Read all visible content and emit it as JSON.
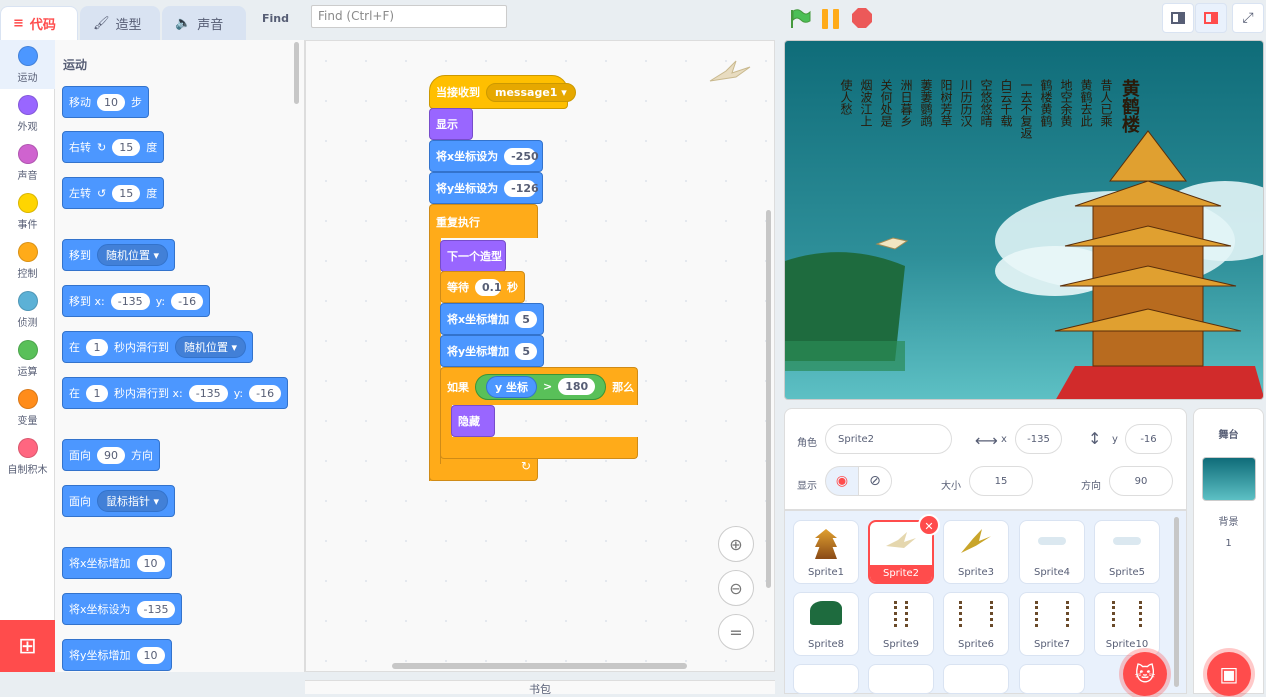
{
  "tabs": [
    {
      "label": "代码",
      "icon": "code-icon"
    },
    {
      "label": "造型",
      "icon": "brush-icon"
    },
    {
      "label": "声音",
      "icon": "speaker-icon"
    }
  ],
  "find": {
    "label": "Find",
    "placeholder": "Find (Ctrl+F)"
  },
  "categories": [
    {
      "label": "运动",
      "color": "#4c97ff"
    },
    {
      "label": "外观",
      "color": "#9966ff"
    },
    {
      "label": "声音",
      "color": "#cf63cf"
    },
    {
      "label": "事件",
      "color": "#ffd500"
    },
    {
      "label": "控制",
      "color": "#ffab19"
    },
    {
      "label": "侦测",
      "color": "#5cb1d6"
    },
    {
      "label": "运算",
      "color": "#59c059"
    },
    {
      "label": "变量",
      "color": "#ff8c1a"
    },
    {
      "label": "自制积木",
      "color": "#ff6680"
    }
  ],
  "palette": {
    "title": "运动",
    "move": {
      "a": "移动",
      "v": "10",
      "b": "步"
    },
    "turn_right": {
      "a": "右转",
      "v": "15",
      "b": "度"
    },
    "turn_left": {
      "a": "左转",
      "v": "15",
      "b": "度"
    },
    "goto": {
      "a": "移到",
      "v": "随机位置"
    },
    "goto_xy": {
      "a": "移到 x:",
      "x": "-135",
      "b": "y:",
      "y": "-16"
    },
    "glide": {
      "a": "在",
      "v": "1",
      "b": "秒内滑行到",
      "d": "随机位置"
    },
    "glide_xy": {
      "a": "在",
      "v": "1",
      "b": "秒内滑行到 x:",
      "x": "-135",
      "c": "y:",
      "y": "-16"
    },
    "point": {
      "a": "面向",
      "v": "90",
      "b": "方向"
    },
    "point_to": {
      "a": "面向",
      "v": "鼠标指针"
    },
    "change_x": {
      "a": "将x坐标增加",
      "v": "10"
    },
    "set_x": {
      "a": "将x坐标设为",
      "v": "-135"
    },
    "change_y": {
      "a": "将y坐标增加",
      "v": "10"
    }
  },
  "script": {
    "hat": {
      "a": "当接收到",
      "v": "message1"
    },
    "show": "显示",
    "setx": {
      "a": "将x坐标设为",
      "v": "-250"
    },
    "sety": {
      "a": "将y坐标设为",
      "v": "-126"
    },
    "forever": "重复执行",
    "nextcostume": "下一个造型",
    "wait": {
      "a": "等待",
      "v": "0.1",
      "b": "秒"
    },
    "changex": {
      "a": "将x坐标增加",
      "v": "5"
    },
    "changey": {
      "a": "将y坐标增加",
      "v": "5"
    },
    "if": {
      "a": "如果",
      "sensor": "y 坐标",
      "op": ">",
      "v": "180",
      "b": "那么"
    },
    "hide": "隐藏"
  },
  "backpack": "书包",
  "sprite_info": {
    "sprite_label": "角色",
    "sprite_name": "Sprite2",
    "x_label": "x",
    "x": "-135",
    "y_label": "y",
    "y": "-16",
    "show_label": "显示",
    "size_label": "大小",
    "size": "15",
    "dir_label": "方向",
    "dir": "90"
  },
  "sprites": [
    "Sprite1",
    "Sprite2",
    "Sprite3",
    "Sprite4",
    "Sprite5",
    "Sprite8",
    "Sprite9",
    "Sprite6",
    "Sprite7",
    "Sprite10"
  ],
  "stage_pane": {
    "title": "舞台",
    "backdrop_label": "背景",
    "backdrop_count": "1"
  },
  "stage_poem": [
    "黄鹤楼",
    "昔人已乘",
    "黄鹤去此",
    "地空余黄",
    "鹤楼黄鹤",
    "一去不复返",
    "白云千载",
    "空悠悠晴",
    "川历历汉",
    "阳树芳草",
    "萋萋鹦鹉",
    "洲日暮乡",
    "关何处是",
    "烟波江上",
    "使人愁"
  ]
}
